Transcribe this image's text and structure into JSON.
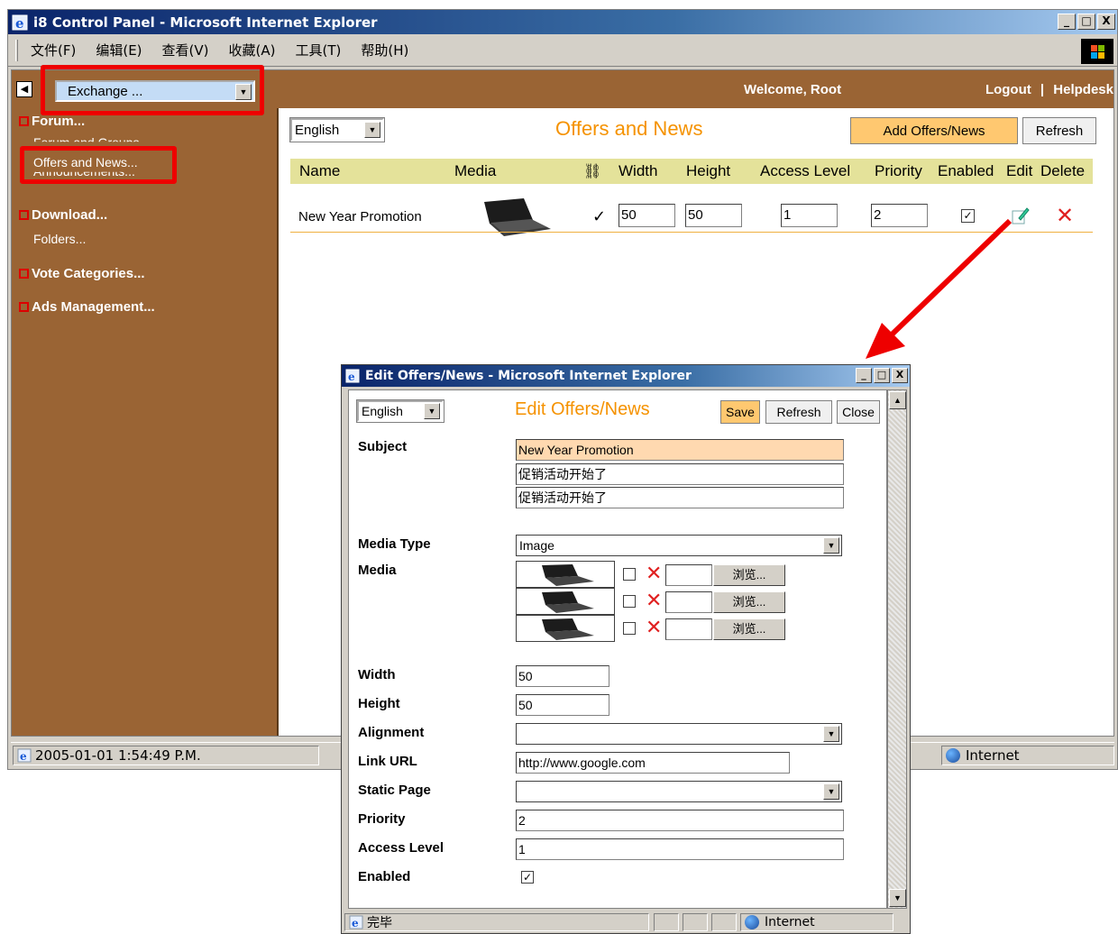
{
  "main_window": {
    "title": "i8 Control Panel - Microsoft Internet Explorer",
    "menu": [
      "文件(F)",
      "编辑(E)",
      "查看(V)",
      "收藏(A)",
      "工具(T)",
      "帮助(H)"
    ],
    "controls": {
      "minimize": "_",
      "maximize": "□",
      "close": "X"
    }
  },
  "header": {
    "module_select": "Exchange ...",
    "welcome": "Welcome, Root",
    "logout": "Logout",
    "separator": "|",
    "helpdesk": "Helpdesk"
  },
  "sidebar": {
    "sections": [
      {
        "title": "Forum...",
        "items": [
          "Forum and Groups...",
          "Offers and News...",
          "Announcements..."
        ]
      },
      {
        "title": "Download...",
        "items": [
          "Folders..."
        ]
      },
      {
        "title": "Vote Categories...",
        "items": []
      },
      {
        "title": "Ads Management...",
        "items": []
      }
    ]
  },
  "main": {
    "language": "English",
    "title": "Offers and News",
    "add_button": "Add Offers/News",
    "refresh_button": "Refresh",
    "columns": [
      "Name",
      "Media",
      "Width",
      "Height",
      "Access Level",
      "Priority",
      "Enabled",
      "Edit",
      "Delete"
    ],
    "rows": [
      {
        "name": "New Year Promotion",
        "media_check": "✓",
        "width": "50",
        "height": "50",
        "access_level": "1",
        "priority": "2",
        "enabled": true
      }
    ]
  },
  "statusbar": {
    "text": "2005-01-01 1:54:49 P.M.",
    "zone": "Internet"
  },
  "popup": {
    "title": "Edit Offers/News - Microsoft Internet Explorer",
    "language": "English",
    "heading": "Edit Offers/News",
    "save": "Save",
    "refresh": "Refresh",
    "close": "Close",
    "labels": {
      "subject": "Subject",
      "media_type": "Media Type",
      "media": "Media",
      "width": "Width",
      "height": "Height",
      "alignment": "Alignment",
      "link_url": "Link URL",
      "static_page": "Static Page",
      "priority": "Priority",
      "access_level": "Access Level",
      "enabled": "Enabled"
    },
    "values": {
      "subject_en": "New Year Promotion",
      "subject_zh1": "促销活动开始了",
      "subject_zh2": "促销活动开始了",
      "media_type": "Image",
      "width": "50",
      "height": "50",
      "alignment": "",
      "link_url": "http://www.google.com",
      "static_page": "",
      "priority": "2",
      "access_level": "1",
      "enabled": true
    },
    "browse_label": "浏览...",
    "status_text": "完毕",
    "zone": "Internet"
  },
  "colors": {
    "sidebar_brown": "#9a6434",
    "title_orange": "#f59200",
    "header_row": "#e4e29a",
    "highlight_red": "#ee0000"
  }
}
